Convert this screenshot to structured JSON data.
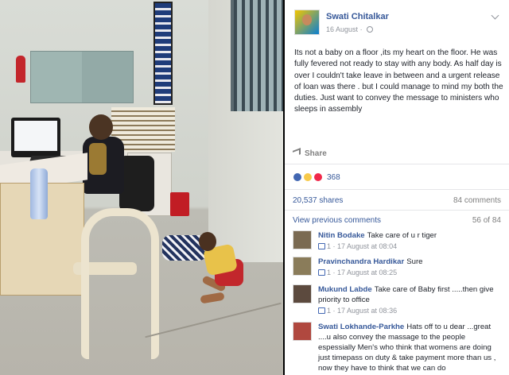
{
  "post": {
    "author": "Swati Chitalkar",
    "date": "16 August",
    "separator": "·",
    "text": "Its not a baby on a floor ,its my heart on the floor. He was fully fevered not ready to stay with any body. As half day is over I couldn't take leave in between and a urgent release of loan was there . but I could manage to mind my both the duties. Just want to convey the message to ministers who sleeps in assembly",
    "share_label": "Share",
    "reaction_count": "368",
    "shares": "20,537 shares",
    "comments": "84 comments",
    "view_previous": "View previous comments",
    "comment_pages": "56 of 84"
  },
  "comments": [
    {
      "name": "Nitin Bodake",
      "text": "Take care of u r tiger",
      "likes": "1",
      "time": "17 August at 08:04",
      "avatar_color": "#7a6a52"
    },
    {
      "name": "Pravinchandra Hardikar",
      "text": "Sure",
      "likes": "1",
      "time": "17 August at 08:25",
      "avatar_color": "#8a7c5a"
    },
    {
      "name": "Mukund Labde",
      "text": "Take care of Baby first .....then give priority to office",
      "likes": "1",
      "time": "17 August at 08:36",
      "avatar_color": "#5c4a3e"
    },
    {
      "name": "Swati Lokhande-Parkhe",
      "text": "Hats off to u dear ...great ....u also convey the massage to the people espessially Men's who think that womens are doing just timepass on duty & take payment more than us , now they have to think that we can do",
      "avatar_color": "#b0483f"
    }
  ],
  "colors": {
    "link": "#365899",
    "meta": "#90949c",
    "text": "#1d2129",
    "like": "#4267b2"
  }
}
